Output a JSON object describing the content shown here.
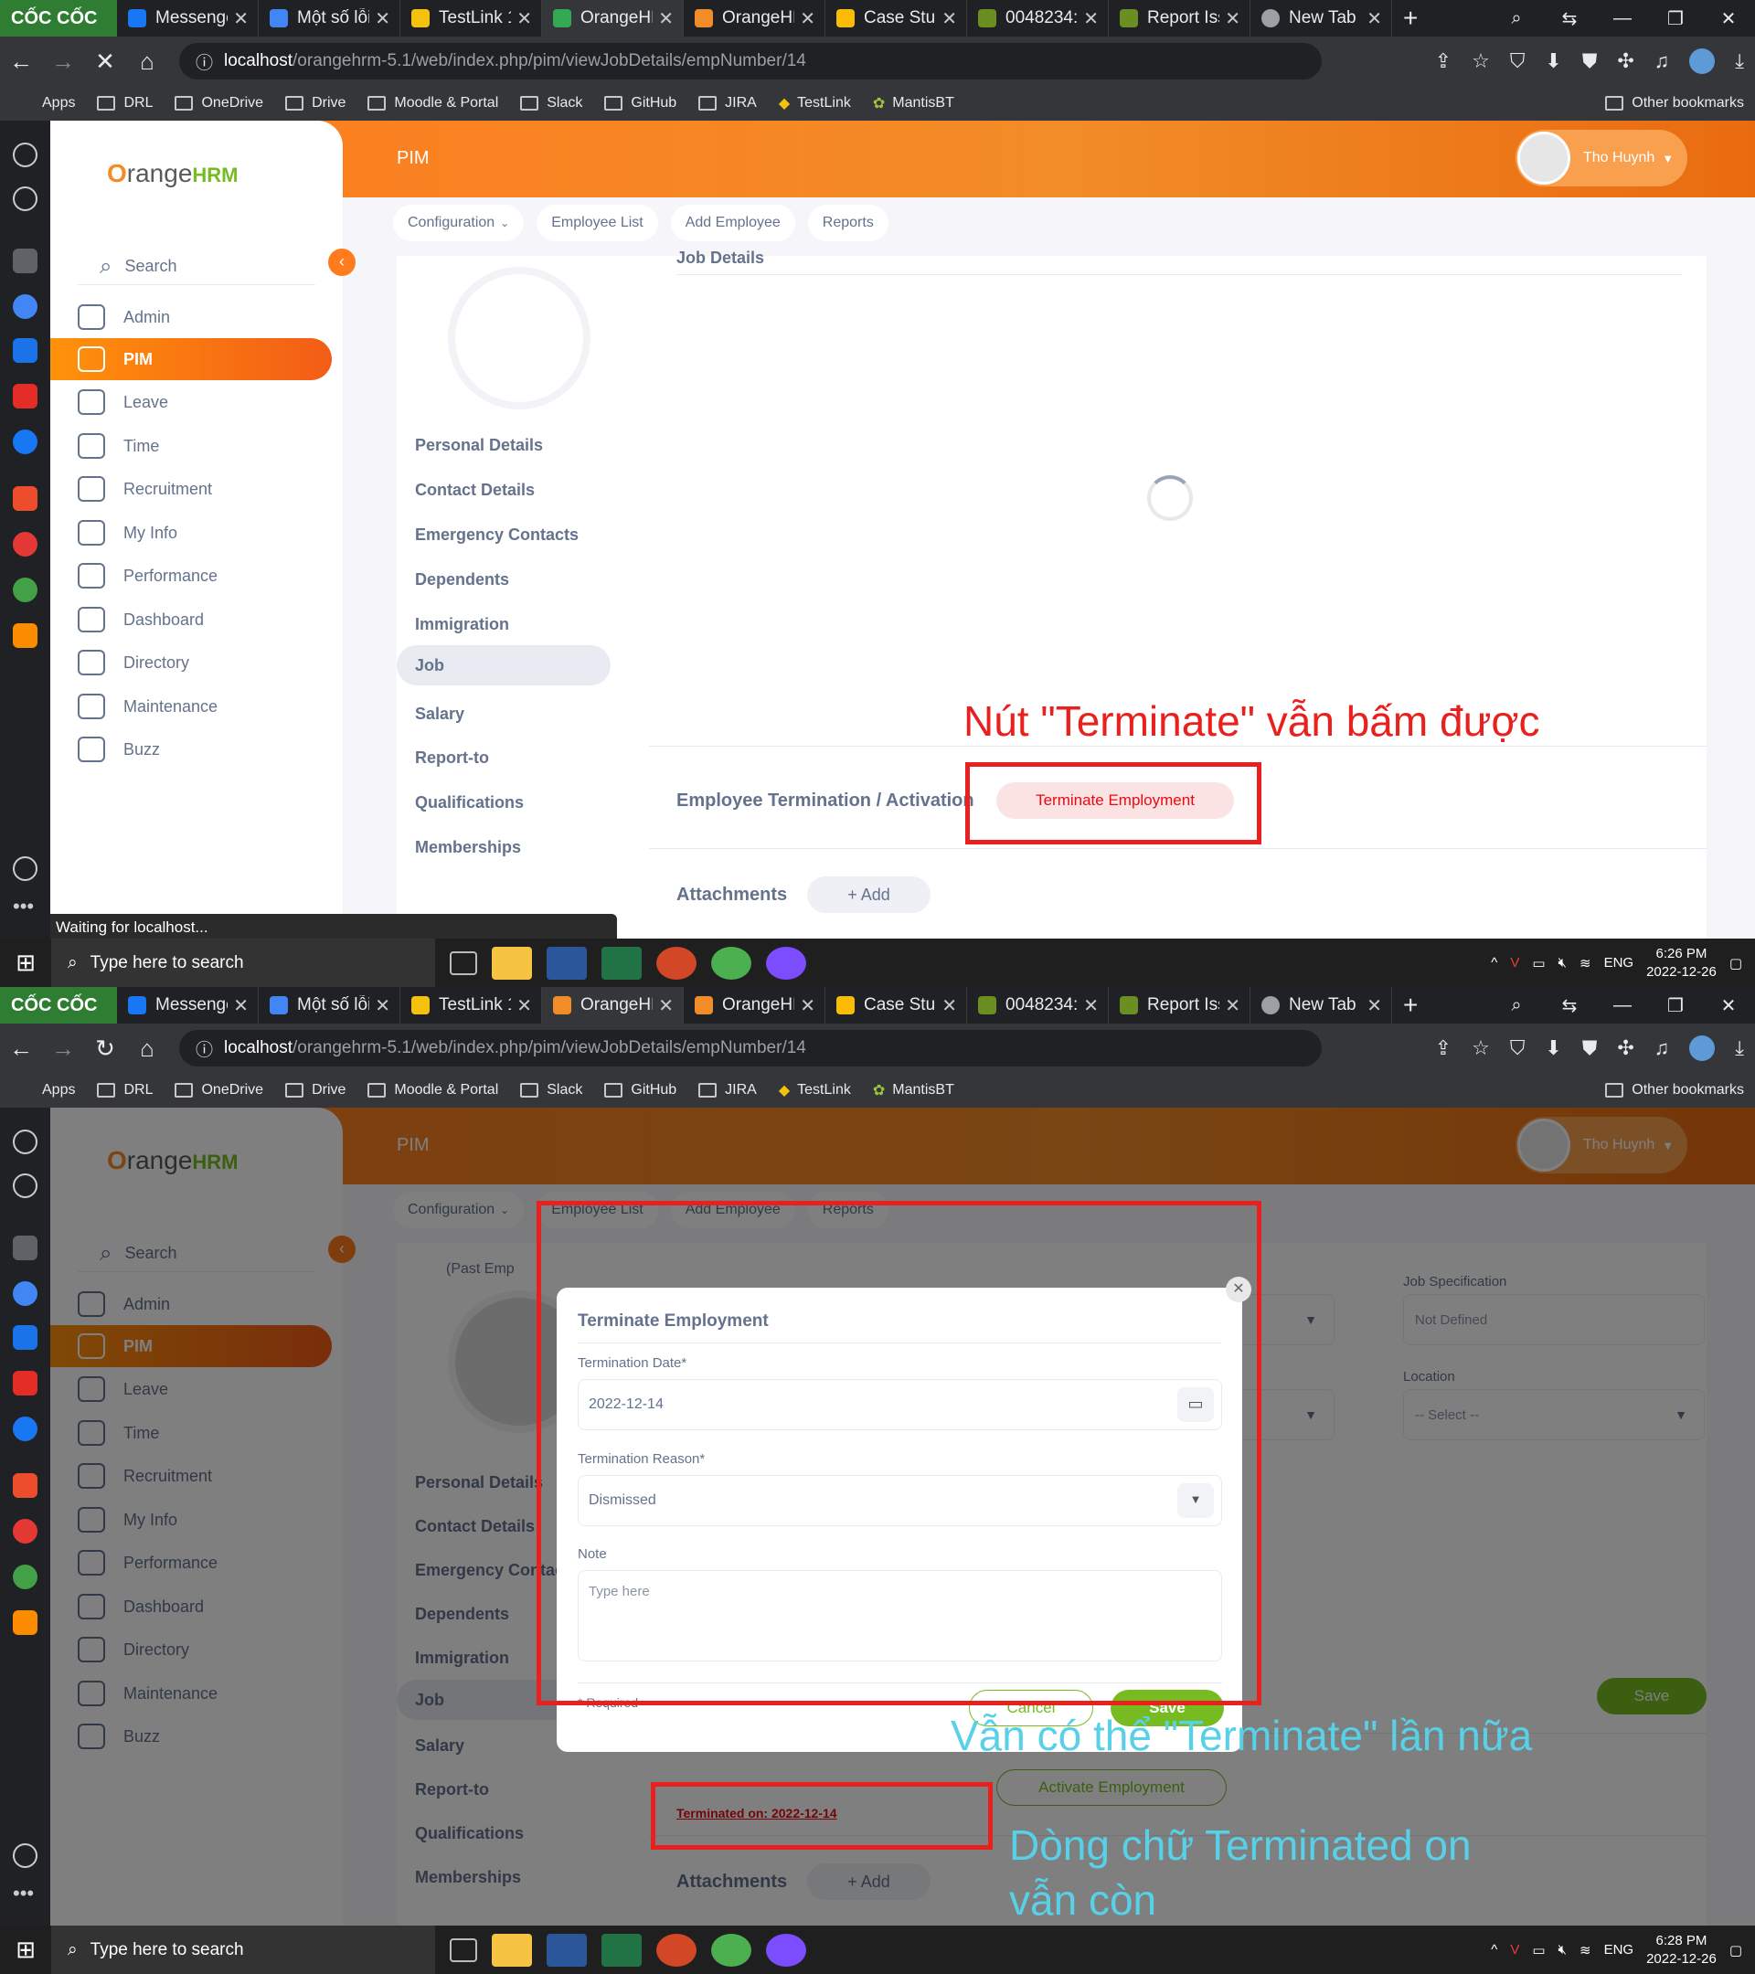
{
  "browser": {
    "brand": "CỐC CỐC",
    "tabs": [
      {
        "label": "Messenge",
        "icon": "facebook-icon",
        "color": "#1877f2"
      },
      {
        "label": "Một số lỗi",
        "icon": "docs-icon",
        "color": "#4285f4"
      },
      {
        "label": "TestLink 1",
        "icon": "testlink-icon",
        "color": "#f4c20d"
      },
      {
        "label": "OrangeHR",
        "icon": "orangehrm-icon",
        "color": "#34a853"
      },
      {
        "label": "OrangeHR",
        "icon": "orangehrm-icon",
        "color": "#f28c28"
      },
      {
        "label": "Case Stud",
        "icon": "drive-icon",
        "color": "#fbbc04"
      },
      {
        "label": "0048234:",
        "icon": "mantis-icon",
        "color": "#6b8e23"
      },
      {
        "label": "Report Iss",
        "icon": "mantis-icon",
        "color": "#6b8e23"
      },
      {
        "label": "New Tab",
        "icon": "coccoc-icon",
        "color": "#9aa0a6"
      }
    ],
    "url_host": "localhost",
    "url_path": "/orangehrm-5.1/web/index.php/pim/viewJobDetails/empNumber/14",
    "bookmarks": [
      "Apps",
      "DRL",
      "OneDrive",
      "Drive",
      "Moodle & Portal",
      "Slack",
      "GitHub",
      "JIRA",
      "TestLink",
      "MantisBT"
    ],
    "other_bookmarks": "Other bookmarks"
  },
  "app": {
    "module_title": "PIM",
    "user_name": "Tho Huynh",
    "logo_text": "range",
    "logo_o": "O",
    "logo_hrm": "HRM",
    "search_label": "Search",
    "menu": [
      "Admin",
      "PIM",
      "Leave",
      "Time",
      "Recruitment",
      "My Info",
      "Performance",
      "Dashboard",
      "Directory",
      "Maintenance",
      "Buzz"
    ],
    "subnav": [
      "Configuration",
      "Employee List",
      "Add Employee",
      "Reports"
    ],
    "employee_tabs": [
      "Personal Details",
      "Contact Details",
      "Emergency Contacts",
      "Dependents",
      "Immigration",
      "Job",
      "Salary",
      "Report-to",
      "Qualifications",
      "Memberships"
    ],
    "job_details_title": "Job Details",
    "termination_title": "Employee Termination / Activation",
    "terminate_button": "Terminate Employment",
    "attachments_title": "Attachments",
    "add_button": "+ Add"
  },
  "shot1": {
    "status_text": "Waiting for localhost...",
    "annotation": "Nút \"Terminate\" vẫn bấm được",
    "clock_time": "6:26 PM",
    "clock_date": "2022-12-26"
  },
  "shot2": {
    "employee_state": "(Past Emp",
    "modal": {
      "title": "Terminate Employment",
      "date_label": "Termination Date*",
      "date_value": "2022-12-14",
      "reason_label": "Termination Reason*",
      "reason_value": "Dismissed",
      "note_label": "Note",
      "note_placeholder": "Type here",
      "required_hint": "* Required",
      "cancel": "Cancel",
      "save": "Save"
    },
    "job_spec_label": "Job Specification",
    "job_spec_value": "Not Defined",
    "location_label": "Location",
    "location_value": "-- Select --",
    "save_button": "Save",
    "activate_button": "Activate Employment",
    "terminated_on": "Terminated on: 2022-12-14",
    "annotation_1": "Vẫn có thể \"Terminate\" lần nữa",
    "annotation_2a": "Dòng chữ Terminated on",
    "annotation_2b": "vẫn còn",
    "clock_time": "6:28 PM",
    "clock_date": "2022-12-26"
  },
  "taskbar": {
    "search_placeholder": "Type here to search",
    "lang": "ENG"
  },
  "colors": {
    "orange_brand": "#ff7b1d",
    "green_brand": "#76bc21",
    "annotation_red": "#e8211f",
    "annotation_cyan": "#58d1e8"
  }
}
